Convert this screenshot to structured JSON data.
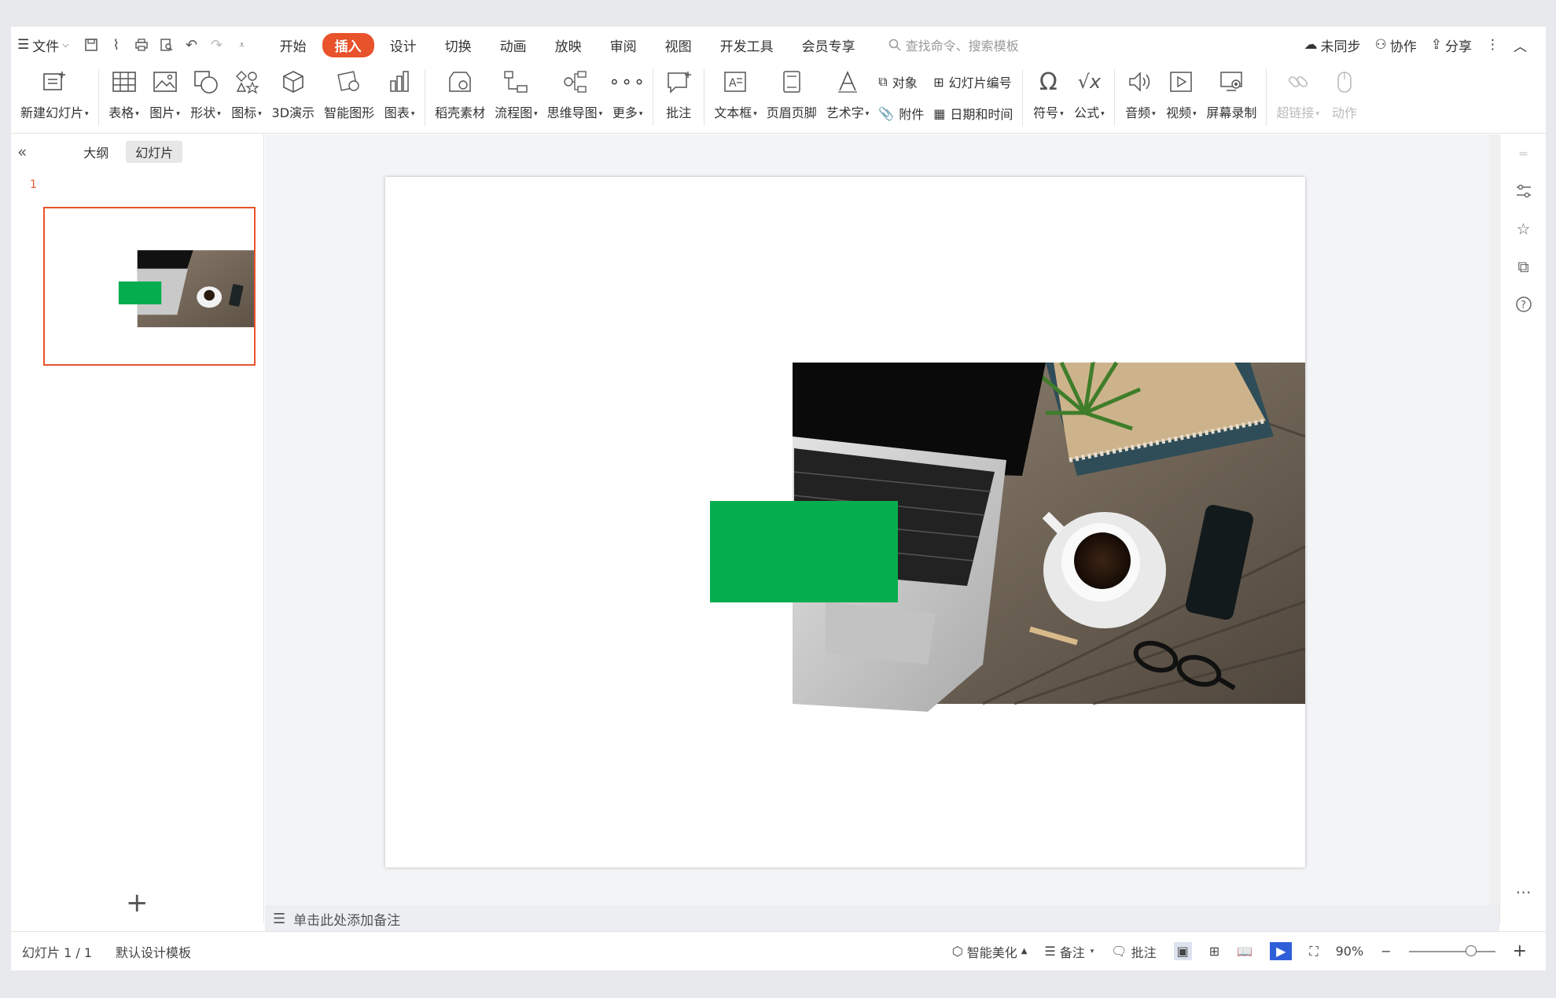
{
  "menu": {
    "file_label": "文件",
    "tabs": [
      "开始",
      "插入",
      "设计",
      "切换",
      "动画",
      "放映",
      "审阅",
      "视图",
      "开发工具",
      "会员专享"
    ],
    "active_tab": "插入",
    "search_placeholder": "查找命令、搜索模板",
    "sync_label": "未同步",
    "collab_label": "协作",
    "share_label": "分享"
  },
  "ribbon": {
    "new_slide": "新建幻灯片",
    "table": "表格",
    "picture": "图片",
    "shape": "形状",
    "icon": "图标",
    "threed": "3D演示",
    "smartart": "智能图形",
    "chart": "图表",
    "material": "稻壳素材",
    "flowchart": "流程图",
    "mindmap": "思维导图",
    "more": "更多",
    "comment": "批注",
    "textbox": "文本框",
    "header_footer": "页眉页脚",
    "wordart": "艺术字",
    "object": "对象",
    "slide_number": "幻灯片编号",
    "attachment": "附件",
    "date_time": "日期和时间",
    "symbol": "符号",
    "formula": "公式",
    "audio": "音频",
    "video": "视频",
    "screen_record": "屏幕录制",
    "hyperlink": "超链接",
    "action": "动作"
  },
  "left_panel": {
    "outline_tab": "大纲",
    "slides_tab": "幻灯片",
    "slide_number": "1"
  },
  "notes_placeholder": "单击此处添加备注",
  "status": {
    "slide_info": "幻灯片 1 / 1",
    "template": "默认设计模板",
    "beautify": "智能美化",
    "notes": "备注",
    "comments": "批注",
    "zoom": "90%"
  },
  "colors": {
    "accent": "#e8532b",
    "green_rect": "#06ad4f"
  }
}
